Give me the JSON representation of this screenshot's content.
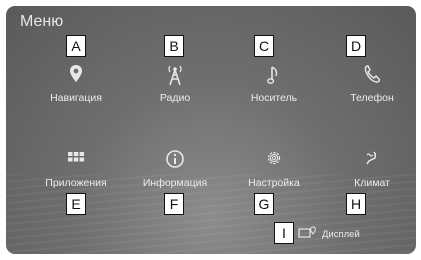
{
  "screen_title": "Меню",
  "menu_items": [
    {
      "label": "Навигация",
      "callout": "A",
      "icon": "navigation-pin-icon"
    },
    {
      "label": "Радио",
      "callout": "B",
      "icon": "radio-tower-icon"
    },
    {
      "label": "Носитель",
      "callout": "C",
      "icon": "music-note-icon"
    },
    {
      "label": "Телефон",
      "callout": "D",
      "icon": "phone-icon"
    },
    {
      "label": "Приложения",
      "callout": "E",
      "icon": "apps-grid-icon"
    },
    {
      "label": "Информация",
      "callout": "F",
      "icon": "info-icon"
    },
    {
      "label": "Настройка",
      "callout": "G",
      "icon": "settings-gear-icon"
    },
    {
      "label": "Климат",
      "callout": "H",
      "icon": "climate-seat-icon"
    }
  ],
  "display_button": {
    "label": "Дисплей",
    "callout": "I",
    "icon": "display-icon"
  },
  "colors": {
    "screen_bg": "#6f6f6f",
    "text": "#ececec"
  }
}
